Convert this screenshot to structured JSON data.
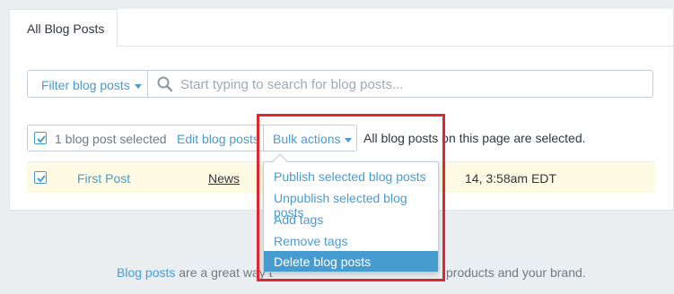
{
  "tabs": [
    {
      "label": "All Blog Posts"
    }
  ],
  "toolbar": {
    "filter_label": "Filter blog posts",
    "search_placeholder": "Start typing to search for blog posts..."
  },
  "bulk_bar": {
    "selection_count_label": "1 blog post selected",
    "edit_label": "Edit blog posts",
    "bulk_actions_label": "Bulk actions",
    "selected_note": "All blog posts on this page are selected."
  },
  "posts": [
    {
      "title": "First Post",
      "tag": "News",
      "date_visible": "14, 3:58am EDT",
      "checked": true
    }
  ],
  "bulk_menu": {
    "items": [
      {
        "label": "Publish selected blog posts"
      },
      {
        "label": "Unpublish selected blog posts"
      },
      {
        "label": "Add tags"
      },
      {
        "label": "Remove tags"
      },
      {
        "label": "Delete blog posts",
        "active": true
      }
    ]
  },
  "footer": {
    "link_text": "Blog posts",
    "text_start": "are a great way t",
    "text_end": "products and your brand."
  },
  "colors": {
    "accent": "#479ccf",
    "highlight_border": "#e1262d",
    "row_selected_bg": "#fefae3"
  },
  "icons": {
    "search": "search-icon",
    "caret": "caret-down-icon",
    "check": "checkmark-icon"
  }
}
